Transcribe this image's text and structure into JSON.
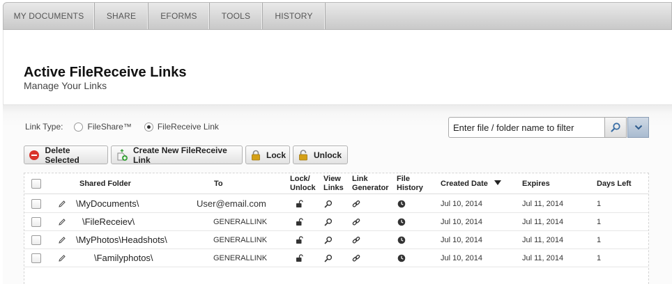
{
  "nav": {
    "tabs": [
      {
        "label": "MY DOCUMENTS"
      },
      {
        "label": "SHARE"
      },
      {
        "label": "EFORMS"
      },
      {
        "label": "TOOLS"
      },
      {
        "label": "HISTORY"
      }
    ]
  },
  "page": {
    "title": "Active FileReceive Links",
    "subtitle": "Manage Your Links"
  },
  "link_type": {
    "label": "Link Type:",
    "options": [
      {
        "label": "FileShare™",
        "selected": false
      },
      {
        "label": "FileReceive Link",
        "selected": true
      }
    ]
  },
  "search": {
    "placeholder": "Enter file / folder name to filter"
  },
  "toolbar": {
    "delete_label": "Delete Selected",
    "create_label": "Create New FileReceive Link",
    "lock_label": "Lock",
    "unlock_label": "Unlock"
  },
  "table": {
    "headers": {
      "shared_folder": "Shared Folder",
      "to": "To",
      "lock_unlock_1": "Lock/",
      "lock_unlock_2": "Unlock",
      "view_links_1": "View",
      "view_links_2": "Links",
      "link_generator_1": "Link",
      "link_generator_2": "Generator",
      "file_history_1": "File",
      "file_history_2": "History",
      "created_date": "Created Date",
      "expires": "Expires",
      "days_left": "Days Left"
    },
    "sort": {
      "column": "created_date",
      "direction": "descending"
    },
    "rows": [
      {
        "folder": "\\MyDocuments\\",
        "to": "User@email.com",
        "created": "Jul 10, 2014",
        "expires": "Jul 11, 2014",
        "days_left": "1"
      },
      {
        "folder": "\\FileReceiev\\",
        "to": "GENERALLINK",
        "created": "Jul 10, 2014",
        "expires": "Jul 11, 2014",
        "days_left": "1"
      },
      {
        "folder": "\\MyPhotos\\Headshots\\",
        "to": "GENERALLINK",
        "created": "Jul 10, 2014",
        "expires": "Jul 11, 2014",
        "days_left": "1"
      },
      {
        "folder": "\\Familyphotos\\",
        "to": "GENERALLINK",
        "created": "Jul 10, 2014",
        "expires": "Jul 11, 2014",
        "days_left": "1"
      }
    ]
  },
  "colors": {
    "accent_blue": "#3a6ea5",
    "delete_red": "#d9342b",
    "lock_gold": "#d4a017",
    "create_green": "#3aa23a"
  }
}
